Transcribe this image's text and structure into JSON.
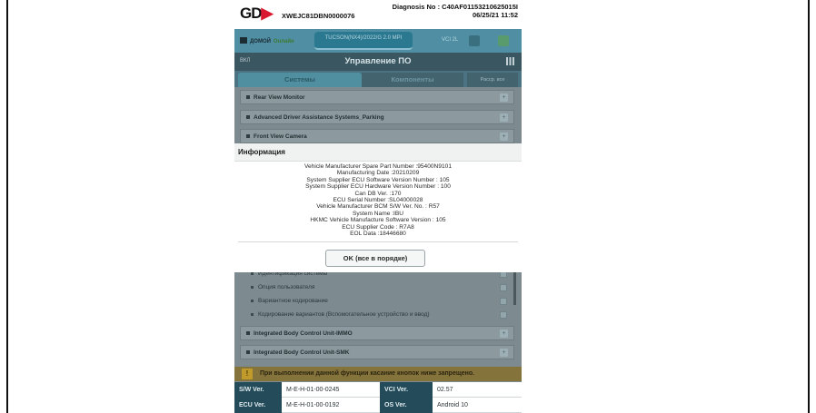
{
  "header": {
    "logo_text": "GD",
    "vin": "XWEJC81DBN0000076",
    "diagnosis_line": "Diagnosis No : C40AF01153210625015I",
    "datetime": "06/25/21 11:52"
  },
  "navbar": {
    "home_label": "ДОМОЙ",
    "home_sub": "Онлайн",
    "vehicle": "TUCSON(NX4)/2022/G 2.0 MPI",
    "vci": "VCI 2L"
  },
  "titlebar": {
    "mini": "ВКЛ",
    "title": "Управление ПО"
  },
  "tabs": {
    "systems": "Системы",
    "components": "Компоненты",
    "expand": "Расср. все"
  },
  "systems": [
    "Rear View Monitor",
    "Advanced Driver Assistance Systems_Parking",
    "Front View Camera"
  ],
  "sub_items": [
    "Идентификация системы",
    "Опция пользователя",
    "Вариантное кодирование",
    "Кодирование вариантов (Вспомогательное устройство и ввод)"
  ],
  "systems_bottom": [
    "Integrated Body Control Unit-IMMO",
    "Integrated Body Control Unit-SMK"
  ],
  "warning": {
    "icon": "!",
    "text": "При выполнении данной функции касание кнопок ниже запрещено."
  },
  "info": [
    {
      "k1": "S/W Ver.",
      "v1": "M-E-H-01-00-0245",
      "k2": "VCI Ver.",
      "v2": "02.57"
    },
    {
      "k1": "ECU Ver.",
      "v1": "M-E-H-01-00-0192",
      "k2": "OS Ver.",
      "v2": "Android 10"
    }
  ],
  "modal": {
    "title": "Информация",
    "lines": [
      "Vehicle Manufacturer Spare Part Number :95400N9101",
      "Manufacturing Date :20210209",
      "System Supplier ECU Software Version Number : 105",
      "System Supplier ECU Hardware Version Number : 100",
      "Can DB Ver. :170",
      "ECU Serial Number :SL04000028",
      "Vehicle Manufacturer BCM S/W Ver. No. : R57",
      "System Name :IBU",
      "HKMC Vehicle Manufacture Software Version : 105",
      "ECU Supplier Code : R7A8",
      "EOL Data :18446680"
    ],
    "ok_label": "OK (все в порядке)"
  },
  "colors": {
    "logo_red": "#d8182e",
    "nav_blue": "#4f8ea3",
    "title_dark": "#3a5660",
    "table_header": "#234b59",
    "warning_bg": "#84733b"
  }
}
